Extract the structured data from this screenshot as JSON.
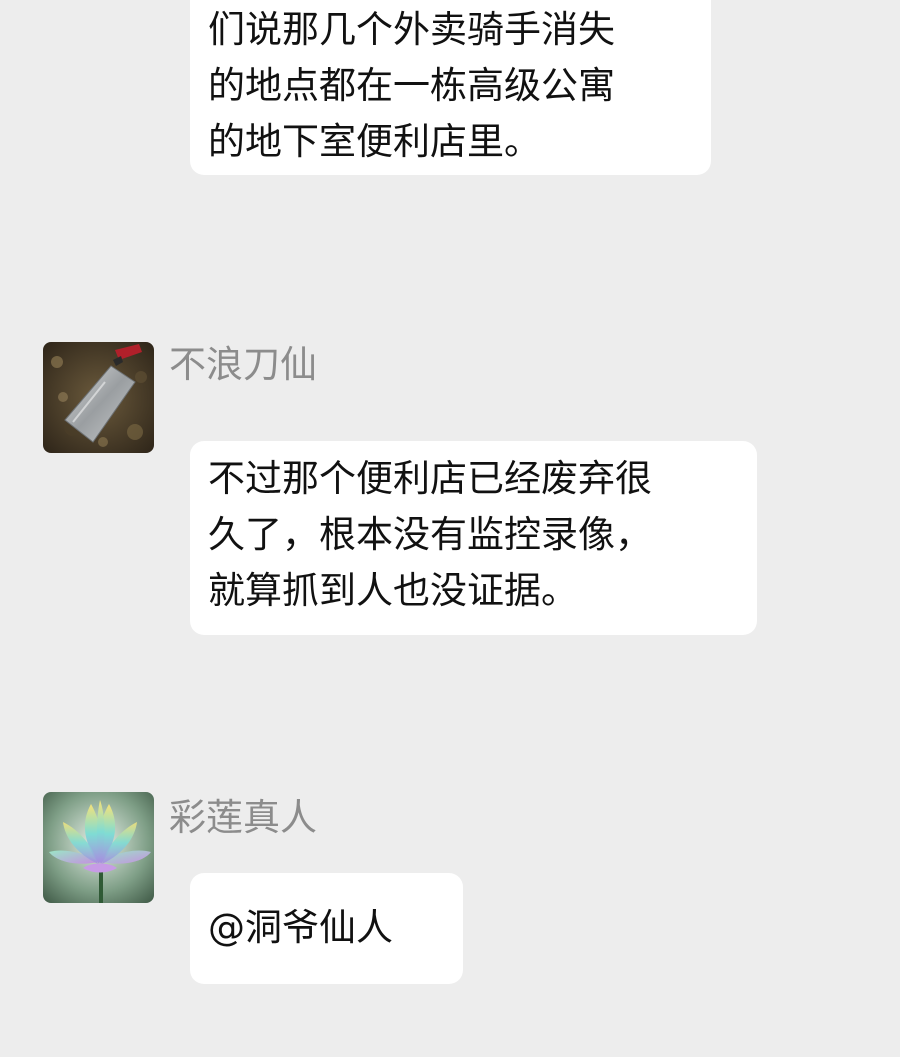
{
  "chat": {
    "messages": [
      {
        "text": "们说那几个外卖骑手消失\n的地点都在一栋高级公寓\n的地下室便利店里。"
      },
      {
        "sender": "不浪刀仙",
        "avatar_icon": "cleaver-knife-icon",
        "text": "不过那个便利店已经废弃很\n久了，根本没有监控录像，\n就算抓到人也没证据。"
      },
      {
        "sender": "彩莲真人",
        "avatar_icon": "rainbow-lotus-icon",
        "text": "@洞爷仙人"
      }
    ]
  },
  "colors": {
    "background": "#ededed",
    "bubble": "#ffffff",
    "sender_name": "#8c8c8c",
    "message_text": "#111111"
  }
}
